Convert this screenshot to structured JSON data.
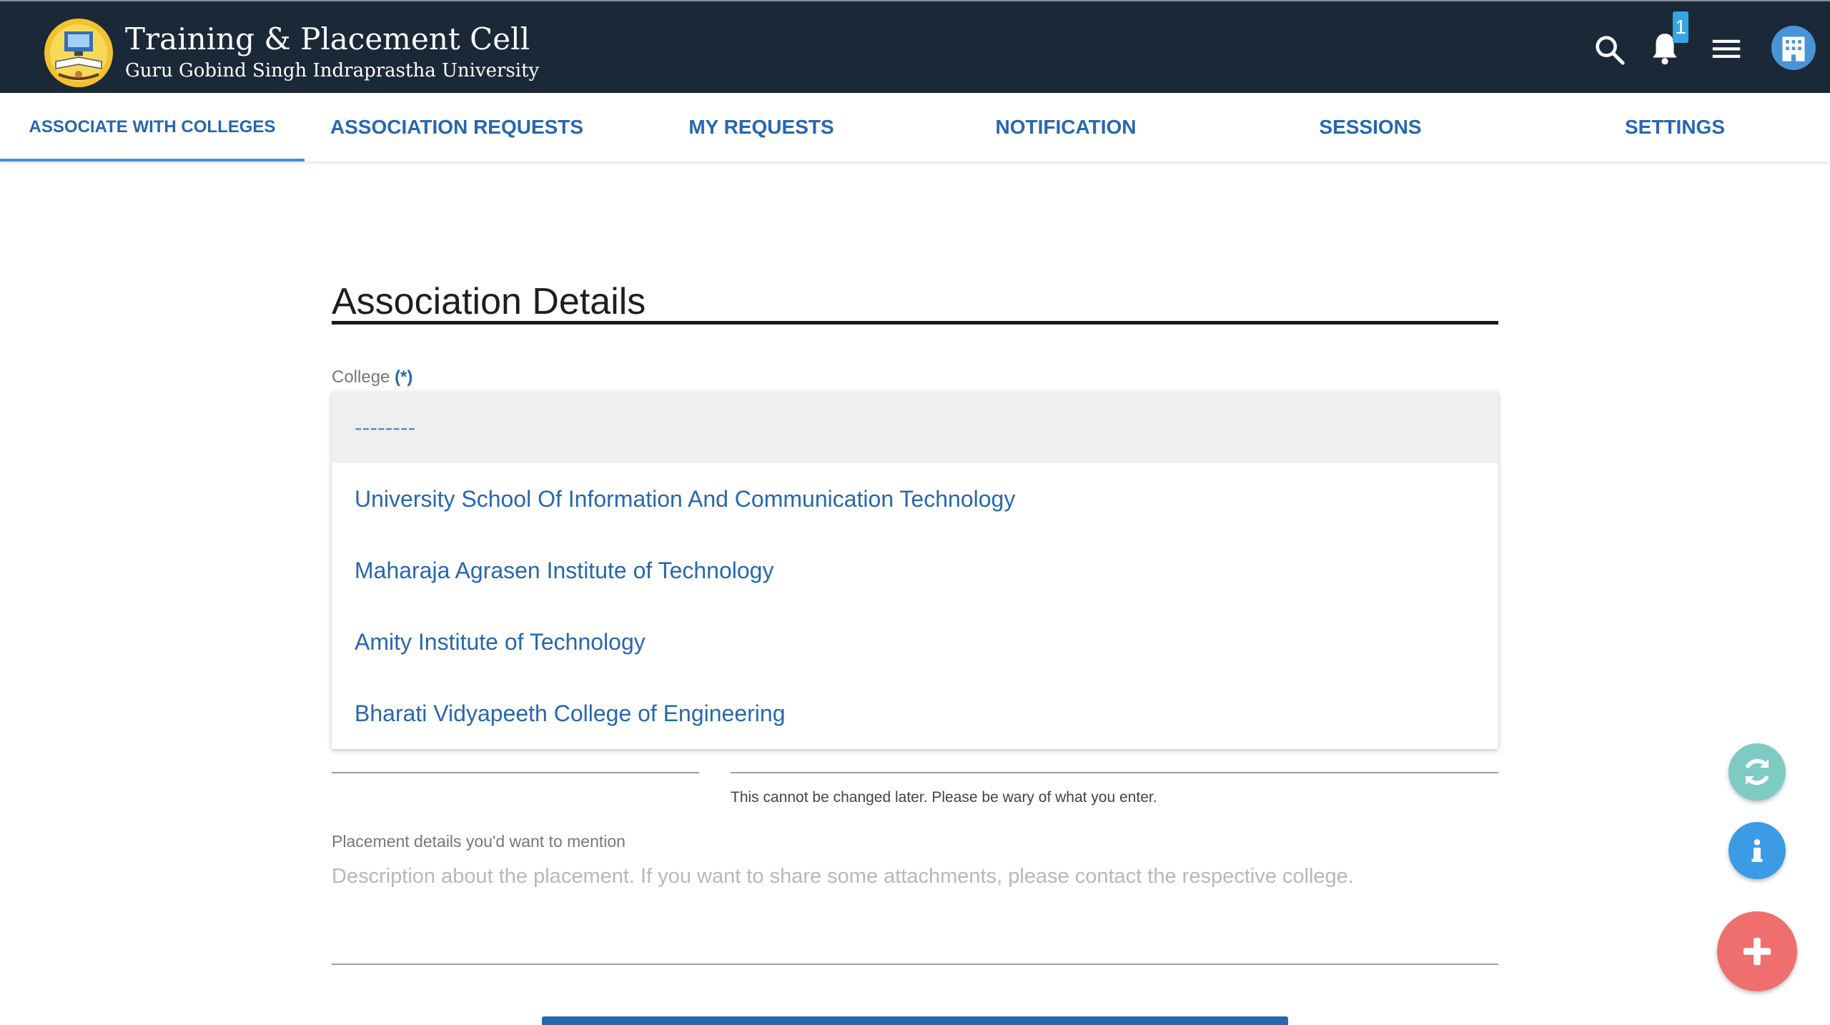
{
  "brand": {
    "title": "Training & Placement Cell",
    "subtitle": "Guru Gobind Singh Indraprastha University"
  },
  "header": {
    "notification_count": "1",
    "icons": [
      "search-icon",
      "bell-icon",
      "menu-icon",
      "building-icon"
    ]
  },
  "tabs": [
    {
      "label": "ASSOCIATE WITH COLLEGES",
      "active": true
    },
    {
      "label": "ASSOCIATION REQUESTS"
    },
    {
      "label": "MY REQUESTS"
    },
    {
      "label": "NOTIFICATION"
    },
    {
      "label": "SESSIONS"
    },
    {
      "label": "SETTINGS"
    }
  ],
  "form": {
    "heading": "Association Details",
    "college_label": "College",
    "required_marker": "(*)",
    "college_options": [
      "--------",
      "University School Of Information And Communication Technology",
      "Maharaja Agrasen Institute of Technology",
      "Amity Institute of Technology",
      "Bharati Vidyapeeth College of Engineering"
    ],
    "hint": "This cannot be changed later. Please be wary of what you enter.",
    "placement_label": "Placement details you'd want to mention",
    "placement_placeholder": "Description about the placement. If you want to share some attachments, please contact the respective college."
  },
  "fabs": [
    "refresh-icon",
    "info-icon",
    "plus-icon"
  ],
  "colors": {
    "topbar": "#1b2838",
    "accent": "#2767ae",
    "fab_refresh": "#7ecbc4",
    "fab_info": "#3b9be4",
    "fab_add": "#ef6f6f"
  }
}
